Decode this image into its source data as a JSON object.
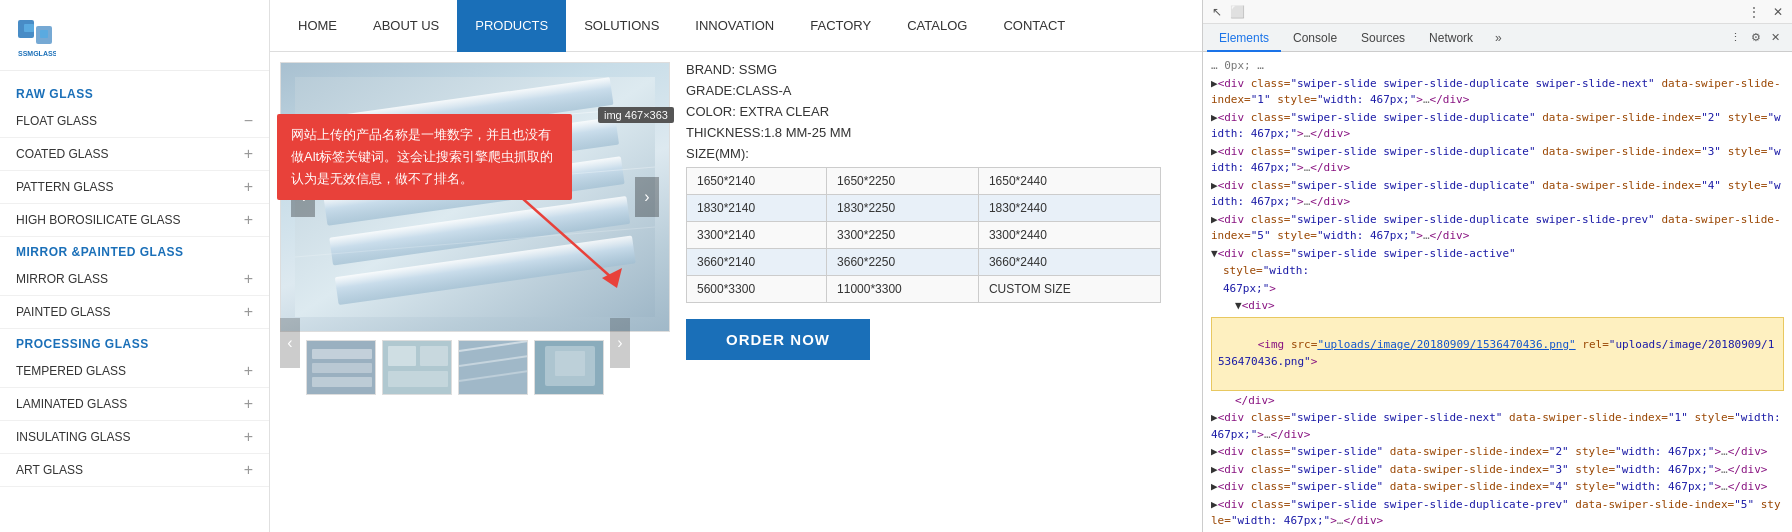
{
  "logo": {
    "text": "SSMGLASS"
  },
  "sidebar": {
    "section1": "RAW GLASS",
    "section2": "MIRROR &PAINTED GLASS",
    "section3": "PROCESSING GLASS",
    "items_raw": [
      {
        "label": "FLOAT GLASS",
        "icon": "minus"
      },
      {
        "label": "COATED GLASS",
        "icon": "plus"
      },
      {
        "label": "PATTERN GLASS",
        "icon": "plus"
      },
      {
        "label": "HIGH BOROSILICATE GLASS",
        "icon": "plus"
      }
    ],
    "items_mirror": [
      {
        "label": "MIRROR GLASS",
        "icon": "plus"
      },
      {
        "label": "PAINTED GLASS",
        "icon": "plus"
      }
    ],
    "items_processing": [
      {
        "label": "TEMPERED GLASS",
        "icon": "plus"
      },
      {
        "label": "LAMINATED GLASS",
        "icon": "plus"
      },
      {
        "label": "INSULATING GLASS",
        "icon": "plus"
      },
      {
        "label": "ART GLASS",
        "icon": "plus"
      }
    ]
  },
  "nav": {
    "items": [
      "HOME",
      "ABOUT US",
      "PRODUCTS",
      "SOLUTIONS",
      "INNOVATION",
      "FACTORY",
      "CATALOG",
      "CONTACT"
    ],
    "active": "PRODUCTS"
  },
  "product": {
    "brand": "BRAND: SSMG",
    "grade": "GRADE:CLASS-A",
    "color": "COLOR: EXTRA CLEAR",
    "thickness": "THICKNESS:1.8 MM-25 MM",
    "size_label": "SIZE(MM):",
    "table": {
      "rows": [
        [
          "1650*2140",
          "1650*2250",
          "1650*2440"
        ],
        [
          "1830*2140",
          "1830*2250",
          "1830*2440"
        ],
        [
          "3300*2140",
          "3300*2250",
          "3300*2440"
        ],
        [
          "3660*2140",
          "3660*2250",
          "3660*2440"
        ],
        [
          "5600*3300",
          "11000*3300",
          "CUSTOM SIZE"
        ]
      ]
    },
    "order_btn": "ORDER NOW"
  },
  "callout": {
    "text": "网站上传的产品名称是一堆数字，并且也没有做Alt标签关键词。这会让搜索引擎爬虫抓取的认为是无效信息，做不了排名。"
  },
  "img_tooltip": {
    "text": "img  467×363"
  },
  "devtools": {
    "tabs": [
      "Elements",
      "Console",
      "Sources",
      "Network"
    ],
    "code_lines": [
      "▶<div class=\"swiper-slide swiper-slide-duplicate swiper-slide-next\" data-swiper-slide-index=\"1\" style=\"width: 467px;\">…</div>",
      "▶<div class=\"swiper-slide swiper-slide-duplicate\" data-swiper-slide-index=\"2\" style=\"width: 467px;\">…</div>",
      "▶<div class=\"swiper-slide swiper-slide-duplicate\" data-swiper-slide-index=\"3\" style=\"width: 467px;\">…",
      "</div>",
      "▶<div class=\"swiper-slide swiper-slide-duplicate\" data-swiper-slide-index=\"4\" style=\"width: 467px;\">…</div>",
      "▶<div class=\"swiper-slide swiper-slide-duplicate swiper-slide-prev\" data-swiper-slide-index=\"5\" style=\"width: 467px;\">…</div>",
      "▼<div class=\"swiper-slide swiper-slide-active\"",
      "   style=\"width:",
      "   467px;\">",
      "  ▼<div>",
      "    <img src=\"uploads/image/20180909/1536470436.png\" rel=\"uploads/image/20180909/1536470436.png\">",
      "  </div>",
      "▶<div class=\"swiper-slide swiper-slide-next\" data-swiper-slide-index=\"1\" style=\"width: 467px;\">…</div>",
      "▶<div class=\"swiper-slide\" data-swiper-slide-index=\"2\" style=\"width: 467px;\">…</div>",
      "▶<div class=\"swiper-slide\" data-swiper-slide-index=\"3\" style=\"width: 467px;\">…</div>",
      "▶<div class=\"swiper-slide\" data-swiper-slide-index=\"4\" style=\"width: 467px;\">…</div>",
      "▶<div class=\"swiper-slide swiper-slide-duplicate-prev\" data-swiper-slide-index=\"5\" style=\"width: 467px;\">…</div>"
    ]
  }
}
